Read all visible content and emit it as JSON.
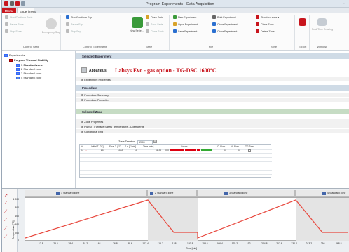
{
  "app": {
    "title": "Program Experiments - Data Acquisition"
  },
  "tabs": {
    "menu": "Menu",
    "experiment": "Experiment"
  },
  "ribbon": {
    "control_serie": {
      "label": "Control Serie",
      "start": "Start/Continue Serie",
      "pause": "Pause Serie",
      "stop": "Stop Serie",
      "emergency": "Emergency Stop"
    },
    "control_experiment": {
      "label": "Control Experiment",
      "start": "Start/Continue Exp.",
      "pause": "Pause Exp.",
      "stop": "Stop Exp."
    },
    "serie": {
      "label": "Serie",
      "new": "New Serie...",
      "open": "Open Serie...",
      "save": "Save Serie...",
      "close": "Close Serie"
    },
    "file": {
      "label": "File",
      "new_exp": "New Experiment...",
      "open_exp": "Open Experiment...",
      "save_exp": "Save Experiment",
      "print_exp": "Print Experiment...",
      "clone_exp": "Clone Experiment",
      "close_exp": "Close Experiment"
    },
    "zone": {
      "label": "Zone",
      "standard": "Standard zone",
      "clone": "Clone Zone",
      "delete": "Delete Zone"
    },
    "export": {
      "label": "Export"
    },
    "window": {
      "label": "Window",
      "realtime": "Real Time Drawing"
    }
  },
  "tree": {
    "root": "Experiments",
    "child": "Polymer Thermal Stability",
    "items": [
      "1 Standard zone",
      "2 Standard zone",
      "3 Standard zone",
      "4 Standard zone"
    ]
  },
  "main": {
    "selected_experiment": "Selected Experiment",
    "apparatus_label": "Apparatus",
    "apparatus_value": "Labsys Evo - gas option - TG-DSC 1600°C",
    "experiment_properties": "Experiment Properties",
    "procedure": "Procedure",
    "procedure_summary": "Procedure Summary",
    "procedure_properties": "Procedure Properties",
    "selected_zone": "Selected Zone",
    "zone_properties": "Zone Properties",
    "pid": "PID(s) - Furnace Safety Temperature - Coefficients",
    "conditional_end": "Conditional End",
    "zone_duration_label": "Zone Duration",
    "zone_duration_value": "2000",
    "table_headers": [
      "#",
      "Initial T. [°C]",
      "Final T. [°C]",
      "S.r. [K/min]",
      "Time [min]",
      "Valves",
      "C. Flow",
      "A. Flow",
      "TG Tare"
    ],
    "table_row": [
      "1",
      "20",
      "1000",
      "10",
      "98:00",
      "",
      "0",
      "0",
      ""
    ]
  },
  "chart": {
    "zone_headers": [
      "1 Standard zone",
      "2 Standard zone",
      "3 Standard zone",
      "4 Standard zone"
    ],
    "ylabel": "Temperature [°C]",
    "xlabel": "Time [min]",
    "yticks": [
      "1 000",
      "800",
      "600",
      "400",
      "200",
      "0"
    ],
    "xticks": [
      "12.8",
      "25.6",
      "38.4",
      "51.2",
      "64",
      "76.8",
      "89.6",
      "102.4",
      "115.2",
      "128",
      "140.8",
      "153.6",
      "166.4",
      "179.2",
      "192",
      "204.8",
      "217.6",
      "230.4",
      "243.2",
      "256",
      "268.8"
    ]
  }
}
